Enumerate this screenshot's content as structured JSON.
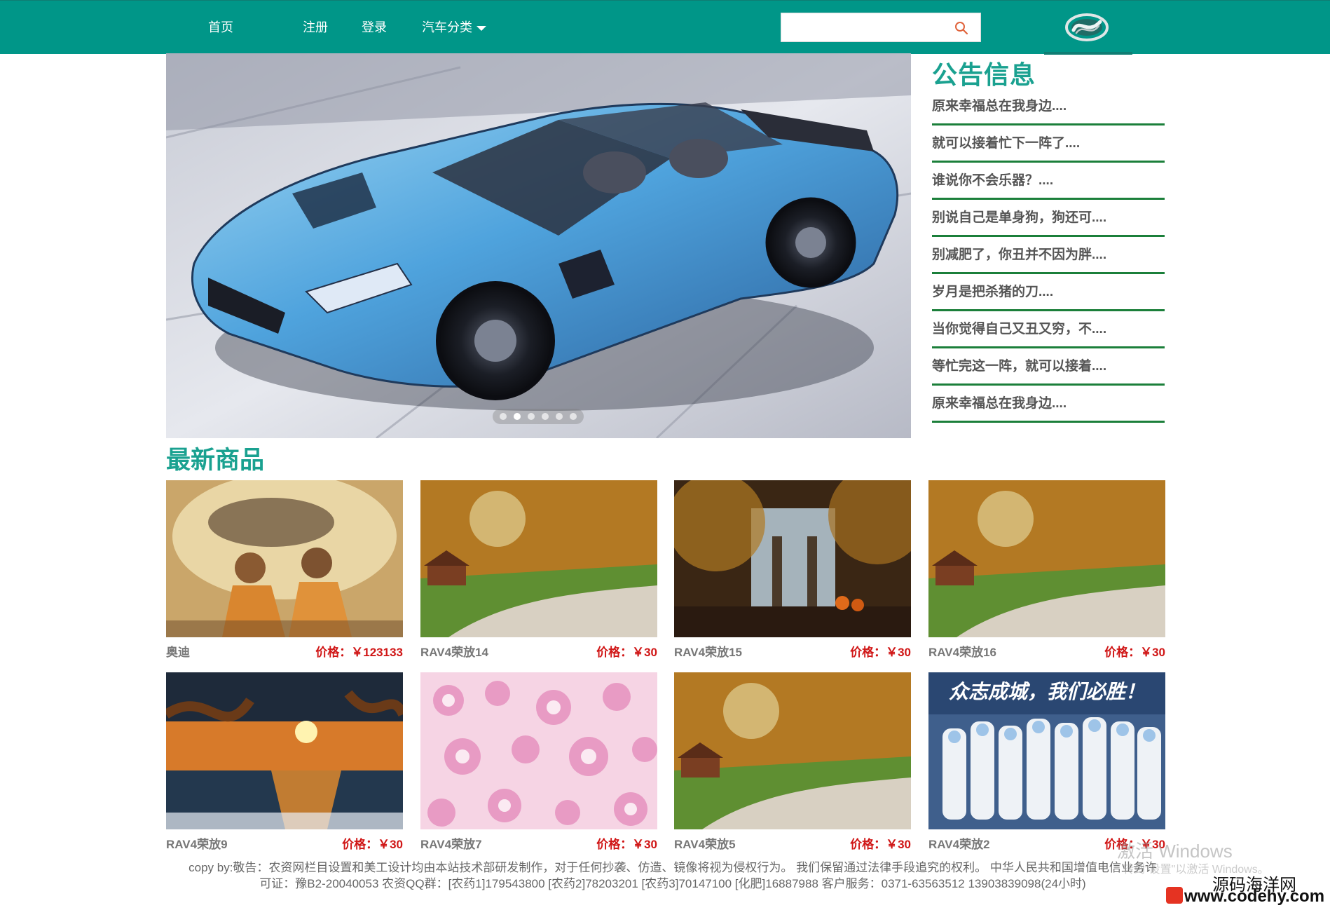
{
  "nav": {
    "items": [
      {
        "label": "首页"
      },
      {
        "label": "注册"
      },
      {
        "label": "登录"
      },
      {
        "label": "汽车分类"
      }
    ],
    "search": {
      "placeholder": "",
      "value": ""
    },
    "colors": {
      "bar": "#009688",
      "text": "#ffffff"
    }
  },
  "banner": {
    "dot_count": 6,
    "active_dot": 2
  },
  "notice": {
    "title": "公告信息",
    "items": [
      {
        "text": "原来幸福总在我身边...."
      },
      {
        "text": "就可以接着忙下一阵了...."
      },
      {
        "text": "谁说你不会乐器？...."
      },
      {
        "text": "别说自己是单身狗，狗还可...."
      },
      {
        "text": "别减肥了，你丑并不因为胖...."
      },
      {
        "text": "岁月是把杀猪的刀...."
      },
      {
        "text": "当你觉得自己又丑又穷，不...."
      },
      {
        "text": "等忙完这一阵，就可以接着...."
      },
      {
        "text": "原来幸福总在我身边...."
      }
    ]
  },
  "products": {
    "title": "最新商品",
    "items": [
      {
        "name": "奥迪",
        "price": "价格：￥123133"
      },
      {
        "name": "RAV4荣放14",
        "price": "价格：￥30"
      },
      {
        "name": "RAV4荣放15",
        "price": "价格：￥30"
      },
      {
        "name": "RAV4荣放16",
        "price": "价格：￥30"
      },
      {
        "name": "RAV4荣放9",
        "price": "价格：￥30"
      },
      {
        "name": "RAV4荣放7",
        "price": "价格：￥30"
      },
      {
        "name": "RAV4荣放5",
        "price": "价格：￥30"
      },
      {
        "name": "RAV4荣放2",
        "price": "价格：￥30",
        "image_caption": "众志成城，我们必胜！"
      }
    ]
  },
  "footer": {
    "line1": "copy by:敬告：农资网栏目设置和美工设计均由本站技术部研发制作，对于任何抄袭、仿造、镜像将视为侵权行为。 我们保留通过法律手段追究的权利。 中华人民共和国增值电信业务许",
    "line2": "可证：豫B2-20040053 农资QQ群：[农药1]179543800 [农药2]78203201 [农药3]70147100 [化肥]16887988 客户服务：0371-63563512 13903839098(24小时)"
  },
  "overlays": {
    "windows_activation": "激活 Windows",
    "windows_activation_sub": "转到\"设置\"以激活 Windows。",
    "site_name": "源码海洋网",
    "site_url": "www.codehy.com"
  }
}
